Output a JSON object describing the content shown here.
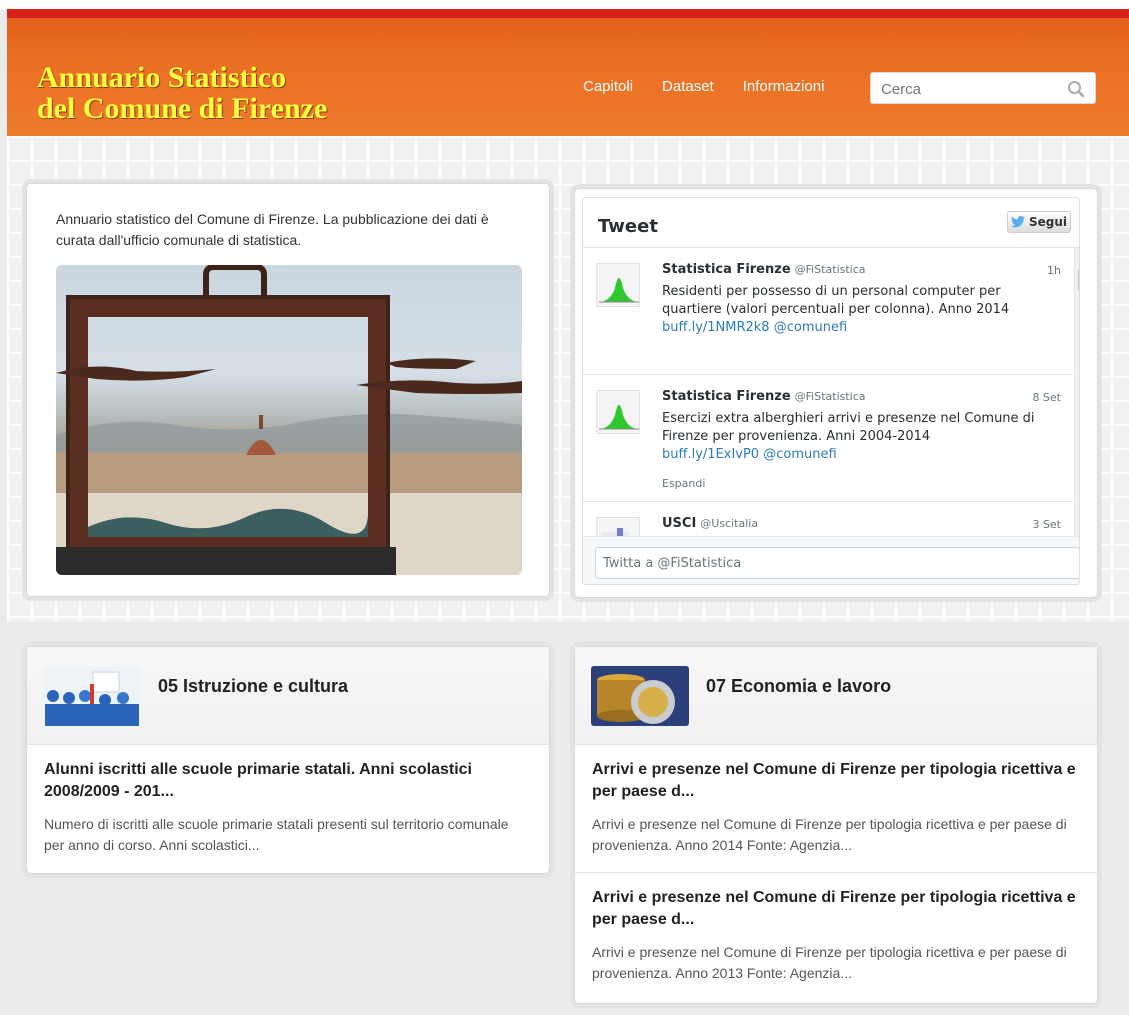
{
  "site": {
    "title_line1": "Annuario Statistico",
    "title_line2": "del Comune di Firenze"
  },
  "nav": {
    "items": [
      "Capitoli",
      "Dataset",
      "Informazioni"
    ]
  },
  "search": {
    "placeholder": "Cerca",
    "icon": "search-icon"
  },
  "intro": {
    "text": "Annuario statistico del Comune di Firenze. La pubblicazione dei dati è curata dall'ufficio comunale di statistica."
  },
  "twitter": {
    "title": "Tweet",
    "follow_label": "Segui",
    "compose_placeholder": "Twitta a @FiStatistica",
    "tweets": [
      {
        "name": "Statistica Firenze",
        "handle": "@FiStatistica",
        "time": "1h",
        "text": "Residenti per possesso di un personal computer per quartiere (valori percentuali per colonna). Anno 2014",
        "links": "buff.ly/1NMR2k8 @comunefi",
        "expand": ""
      },
      {
        "name": "Statistica Firenze",
        "handle": "@FiStatistica",
        "time": "8 Set",
        "text": "Esercizi extra alberghieri arrivi e presenze nel Comune di Firenze per provenienza. Anni 2004-2014",
        "links": "buff.ly/1ExIvP0 @comunefi",
        "expand": "Espandi"
      },
      {
        "name": "USCI",
        "handle": "@Uscitalia",
        "time": "3 Set",
        "text": "",
        "links": "",
        "expand": ""
      }
    ]
  },
  "categories": [
    {
      "title": "05 Istruzione e cultura",
      "items": [
        {
          "heading": "Alunni iscritti alle scuole primarie statali. Anni scolastici 2008/2009 - 201...",
          "summary": "Numero di iscritti alle scuole primarie statali presenti sul territorio comunale per anno di corso. Anni scolastici..."
        }
      ]
    },
    {
      "title": "07 Economia e lavoro",
      "items": [
        {
          "heading": "Arrivi e presenze nel Comune di Firenze per tipologia ricettiva e per paese d...",
          "summary": "Arrivi e presenze nel Comune di Firenze per tipologia ricettiva e per paese di provenienza. Anno 2014 Fonte: Agenzia..."
        },
        {
          "heading": "Arrivi e presenze nel Comune di Firenze per tipologia ricettiva e per paese d...",
          "summary": "Arrivi e presenze nel Comune di Firenze per tipologia ricettiva e per paese di provenienza. Anno 2013 Fonte: Agenzia..."
        }
      ]
    }
  ],
  "colors": {
    "header": "#ea6f23",
    "title_yellow": "#ffff3c",
    "red_bar": "#d8201a",
    "twitter_link": "#2b7bb9"
  }
}
